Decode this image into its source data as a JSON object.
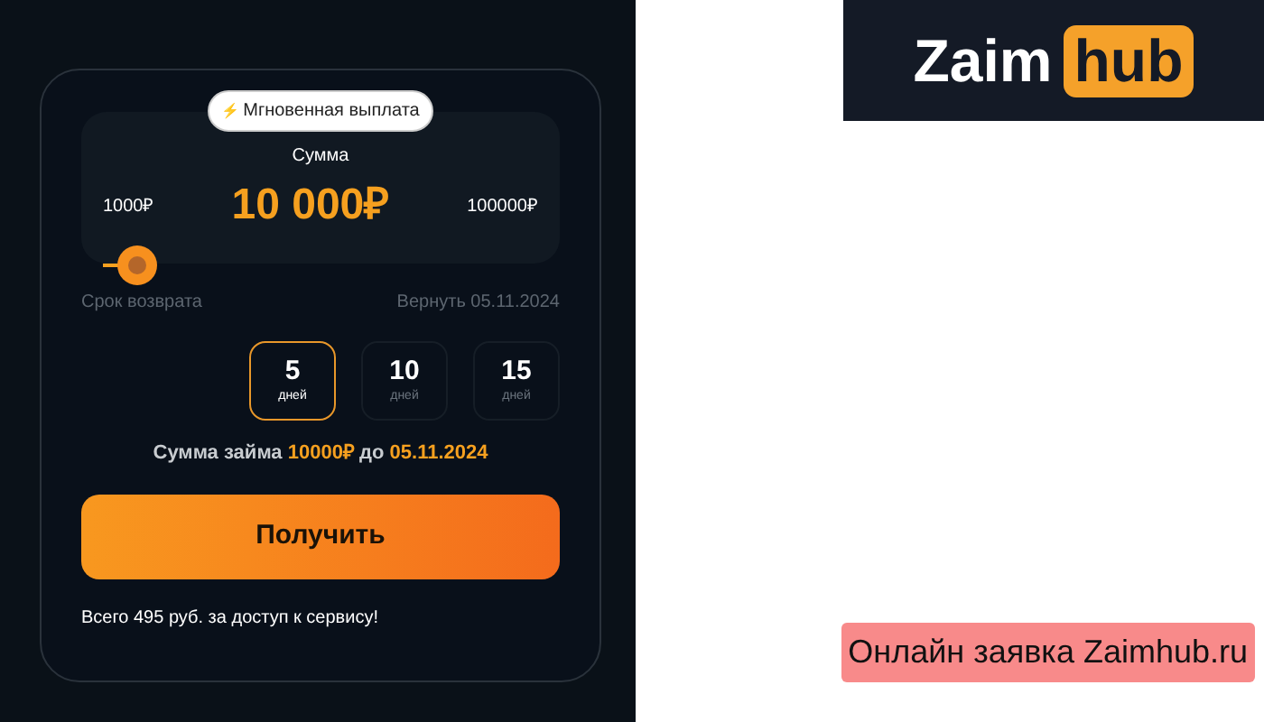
{
  "badge": {
    "icon": "⚡",
    "label": "Мгновенная выплата"
  },
  "amount": {
    "label": "Сумма",
    "min": "1000₽",
    "value": "10 000₽",
    "max": "100000₽",
    "level": 0.04
  },
  "term": {
    "label": "Срок возврата",
    "return_date": "Вернуть 05.11.2024"
  },
  "days": [
    {
      "number": "5",
      "unit": "дней",
      "selected": true
    },
    {
      "number": "10",
      "unit": "дней",
      "selected": false
    },
    {
      "number": "15",
      "unit": "дней",
      "selected": false
    }
  ],
  "summary": "Сумма займа **10000₽** до **05.11.2024**",
  "submit_button": "Получить",
  "note": "Всего 495 руб. за доступ к сервису!",
  "logo": {
    "word": "Zaim",
    "highlight": "hub"
  },
  "banner": "Онлайн заявка Zaimhub.ru"
}
